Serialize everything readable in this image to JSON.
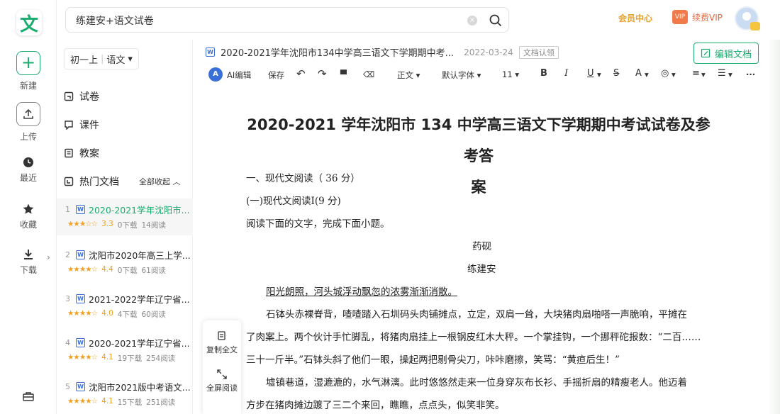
{
  "rail": {
    "logo": "文",
    "new_label": "新建",
    "upload_label": "上传",
    "recent_label": "最近",
    "fav_label": "收藏",
    "download_label": "下载"
  },
  "search": {
    "value": "练建安+语文试卷"
  },
  "header": {
    "member": "会员中心",
    "vip": "续费VIP",
    "gift_text": "VIP"
  },
  "sidebar": {
    "grade": "初一上",
    "subject": "语文",
    "items": [
      "试卷",
      "课件",
      "教案"
    ],
    "hot_label": "热门文档",
    "fold_label": "全部收起",
    "docs": [
      {
        "num": "1",
        "title": "2020-2021学年沈阳市...",
        "stars": "★★★☆☆",
        "score": "3.3",
        "downloads": "0下载",
        "reads": "14阅读"
      },
      {
        "num": "2",
        "title": "沈阳市2020年高三上学...",
        "stars": "★★★★☆",
        "score": "4.4",
        "downloads": "0下载",
        "reads": "61阅读"
      },
      {
        "num": "3",
        "title": "2021-2022学年辽宁省...",
        "stars": "★★★★☆",
        "score": "4.0",
        "downloads": "4下载",
        "reads": "60阅读"
      },
      {
        "num": "4",
        "title": "2020-2021学年辽宁省...",
        "stars": "★★★★☆",
        "score": "4.1",
        "downloads": "19下载",
        "reads": "254阅读"
      },
      {
        "num": "5",
        "title": "沈阳市2021版中考语文...",
        "stars": "★★★★☆",
        "score": "4.1",
        "downloads": "15下载",
        "reads": "251阅读"
      }
    ]
  },
  "document": {
    "header_title": "2020-2021学年沈阳市134中学高三语文下学期期中考...",
    "date": "2022-03-24",
    "tag": "文档认领",
    "edit_label": "编辑文档",
    "title_line1": "2020-2021 学年沈阳市 134 中学高三语文下学期期中考试试卷及参考答",
    "title_line2": "案",
    "section1": "一、现代文阅读（ 36 分）",
    "section1_sub": "(一)现代文阅读Ⅰ(9 分)",
    "instruction": "阅读下面的文字，完成下面小题。",
    "story_title": "药砚",
    "author": "练建安",
    "para0": "阳光朗照，河头城浮动飘忽的浓雾渐渐消散。",
    "para1_l1": "石钵头赤裸脊背，喳喳踏入石圳码头肉铺摊点，立定，双肩一耸，大块猪肉扇啪嗒一声脆响，平摊在",
    "para1_l2": "了肉案上。两个伙计手忙脚乱，将猪肉扇挂上一根钢皮红木大秤。一个掌挂钩，一个挪秤砣报数：“二百……",
    "para1_l3": "三十一斤半。”石钵头斜了他们一眼，操起两把剔骨尖刀，咔咔磨擦，笑骂：“黄疸后生！”",
    "para2_l1": "墟镇巷道，湿漉漉的，水气淋漓。此时悠悠然走来一位身穿灰布长衫、手摇折扇的精瘦老人。他迈着",
    "para2_l2": "方步在猪肉摊边踱了三二个来回，瞧瞧，点点头，似笑非笑。"
  },
  "toolbar": {
    "ai": "AI编辑",
    "save": "保存",
    "style": "正文",
    "font": "默认字体",
    "size": "11"
  },
  "float_tools": {
    "copy": "复制全文",
    "fullscreen": "全屏阅读"
  },
  "colors": {
    "brand": "#1aad6f",
    "gold": "#e8a02a",
    "star": "#f0a020",
    "link": "#3b6fd8"
  }
}
